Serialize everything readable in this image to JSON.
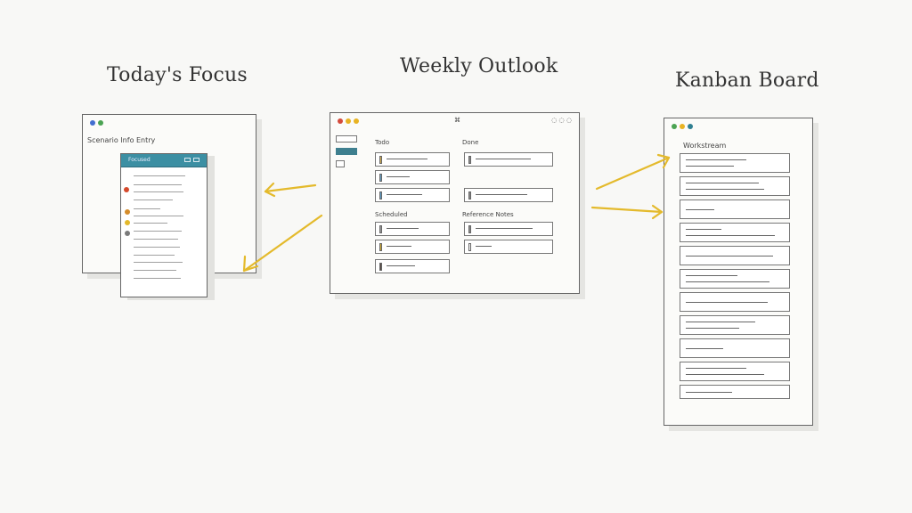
{
  "sections": {
    "left_title": "Today's Focus",
    "middle_title": "Weekly Outlook",
    "right_title": "Kanban Board"
  },
  "colors": {
    "accent_yellow": "#e4ba2c",
    "accent_teal": "#3c8fa3",
    "window_outline": "#666666"
  },
  "left_window": {
    "header_text": "Scenario Info Entry",
    "panel_header": "Focused"
  },
  "middle_window": {
    "column_a_heading": "Todo",
    "column_b_heading": "Done",
    "section_a2": "Scheduled",
    "section_b2": "Reference Notes"
  },
  "right_window": {
    "header_text": "Workstream"
  }
}
